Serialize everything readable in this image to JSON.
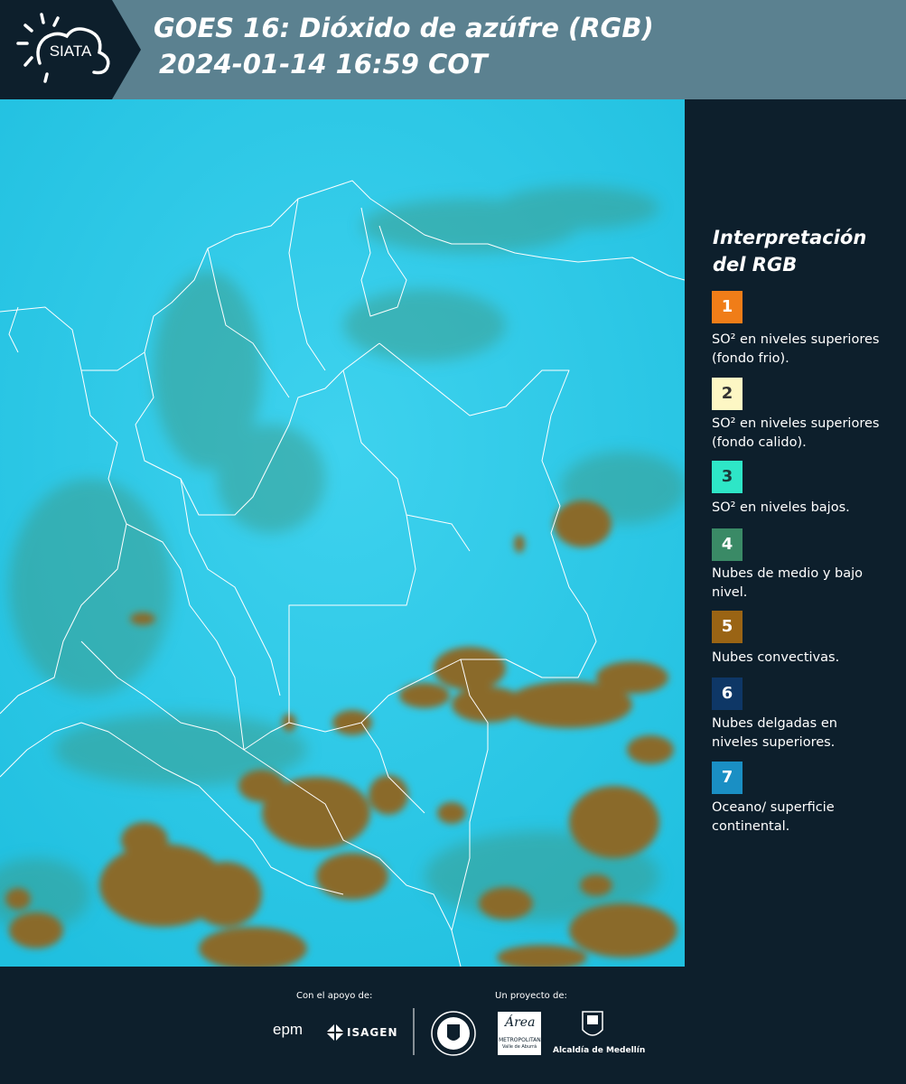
{
  "header": {
    "logo_text": "SIATA",
    "title_line1": "GOES 16: Dióxido de azúfre (RGB)",
    "title_line2": "2024-01-14 16:59 COT"
  },
  "map": {
    "description_color_ocean": "#1fc7e6",
    "description_color_convective": "#8b6a2e"
  },
  "legend": {
    "title": "Interpretación del RGB",
    "items": [
      {
        "number": "1",
        "color": "#f07d18",
        "text_color": "#ffffff",
        "label": "SO² en niveles superiores (fondo frio)."
      },
      {
        "number": "2",
        "color": "#fdf7c4",
        "text_color": "#333333",
        "label": "SO² en niveles superiores (fondo calido)."
      },
      {
        "number": "3",
        "color": "#2ee6c7",
        "text_color": "#1b3a3a",
        "label": "SO² en niveles bajos."
      },
      {
        "number": "4",
        "color": "#3a8a66",
        "text_color": "#ffffff",
        "label": "Nubes de medio y bajo nivel."
      },
      {
        "number": "5",
        "color": "#9a6414",
        "text_color": "#ffffff",
        "label": "Nubes convectivas."
      },
      {
        "number": "6",
        "color": "#0e3766",
        "text_color": "#ffffff",
        "label": "Nubes delgadas en niveles superiores."
      },
      {
        "number": "7",
        "color": "#1a8fc4",
        "text_color": "#ffffff",
        "label": "Oceano/ superficie continental."
      }
    ]
  },
  "footer": {
    "support_caption": "Con el apoyo de:",
    "project_caption": "Un proyecto de:",
    "epm": "epm",
    "isagen": "ISAGEN",
    "area_label": "Área",
    "area_sub": "METROPOLITANA",
    "area_sub2": "Valle de Aburrá",
    "alcaldia": "Alcaldía de Medellín"
  }
}
